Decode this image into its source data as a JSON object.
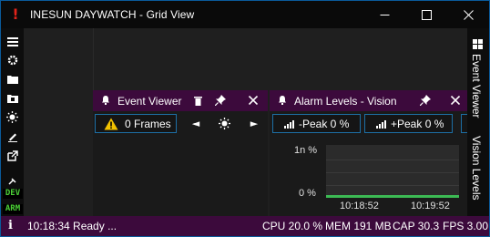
{
  "window": {
    "title": "INESUN DAYWATCH - Grid View",
    "app_icon": "exclamation-icon",
    "controls": [
      "minimize",
      "maximize",
      "close"
    ]
  },
  "left_toolbar": {
    "icons": [
      "menu-icon",
      "settings-icon",
      "folder-icon",
      "save-folder-icon",
      "brightness-icon",
      "edit-icon",
      "external-link-icon",
      "tools-icon"
    ],
    "tags": [
      "DEV",
      "ARM"
    ]
  },
  "right_strip": {
    "tabs": [
      "Event Viewer",
      "Vision Levels"
    ]
  },
  "event_viewer": {
    "title": "Event Viewer",
    "frames_label": "0 Frames",
    "nav": {
      "prev": "◄",
      "next": "►"
    }
  },
  "alarm_levels": {
    "title": "Alarm Levels - Vision",
    "neg_peak_label": "-Peak 0 %",
    "pos_peak_label": "+Peak 0 %"
  },
  "chart_data": {
    "type": "line",
    "y_tick_labels": [
      "1n %",
      "0 %"
    ],
    "x_tick_labels": [
      "10:18:52",
      "10:19:52"
    ],
    "series": [
      {
        "values": [
          0,
          0
        ],
        "color": "#3cba54"
      }
    ],
    "ylim": [
      0,
      1
    ],
    "grid": true
  },
  "status": {
    "message": "10:18:34 Ready ...",
    "cpu": "CPU 20.0 %",
    "mem": "MEM 191 MB",
    "cap": "CAP 30.3",
    "fps": "FPS 3.00"
  },
  "colors": {
    "accent_purple": "#3c0a3c",
    "button_border": "#1d6fa5",
    "tag_green": "#4cd137",
    "series_green": "#3cba54",
    "brand_red": "#e2231a"
  }
}
